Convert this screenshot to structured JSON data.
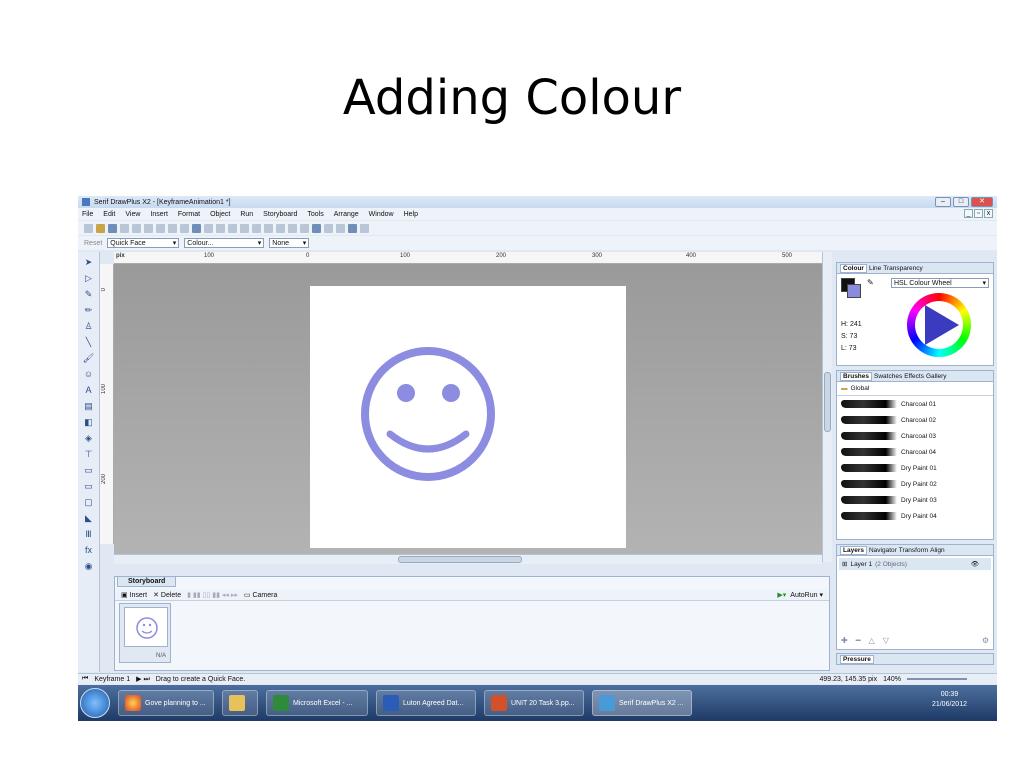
{
  "slide": {
    "title": "Adding Colour"
  },
  "window": {
    "title": "Serif DrawPlus X2 - [KeyframeAnimation1 *]"
  },
  "menu": [
    "File",
    "Edit",
    "View",
    "Insert",
    "Format",
    "Object",
    "Run",
    "Storyboard",
    "Tools",
    "Arrange",
    "Window",
    "Help"
  ],
  "context_toolbar": {
    "reset": "Reset",
    "shape": "Quick Face",
    "colour": "Colour...",
    "line": "None"
  },
  "ruler": {
    "unit": "pix",
    "h_ticks": [
      "100",
      "0",
      "100",
      "200",
      "300",
      "400",
      "500"
    ],
    "v_ticks": [
      "0",
      "100",
      "200"
    ]
  },
  "colour_panel": {
    "tabs": [
      "Colour",
      "Line",
      "Transparency"
    ],
    "mode": "HSL Colour Wheel",
    "h": "H: 241",
    "s": "S: 73",
    "l": "L: 73",
    "fill_color": "#8b8bde"
  },
  "brushes_panel": {
    "tabs": [
      "Brushes",
      "Swatches",
      "Effects",
      "Gallery"
    ],
    "category": "Global",
    "items": [
      "Charcoal 01",
      "Charcoal 02",
      "Charcoal 03",
      "Charcoal 04",
      "Dry Paint 01",
      "Dry Paint 02",
      "Dry Paint 03",
      "Dry Paint 04"
    ]
  },
  "layers_panel": {
    "tabs": [
      "Layers",
      "Navigator",
      "Transform",
      "Align"
    ],
    "layer": "Layer 1",
    "objects": "(2 Objects)"
  },
  "pressure_tab": "Pressure",
  "storyboard": {
    "tab": "Storyboard",
    "insert": "Insert",
    "delete": "Delete",
    "camera": "Camera",
    "autorun": "AutoRun",
    "frame_label": "N/A"
  },
  "status": {
    "keyframe": "Keyframe 1",
    "hint": "Drag to create a Quick Face.",
    "coords": "499.23, 145.35 pix",
    "zoom": "140%"
  },
  "taskbar": {
    "items": [
      "Gove planning to ...",
      "",
      "Microsoft Excel - ...",
      "Luton Agreed Dat...",
      "UNIT 20 Task 3.pp...",
      "Serif DrawPlus X2 ..."
    ],
    "time": "00:39",
    "date": "21/06/2012"
  },
  "smiley_color": "#8c8ce0"
}
